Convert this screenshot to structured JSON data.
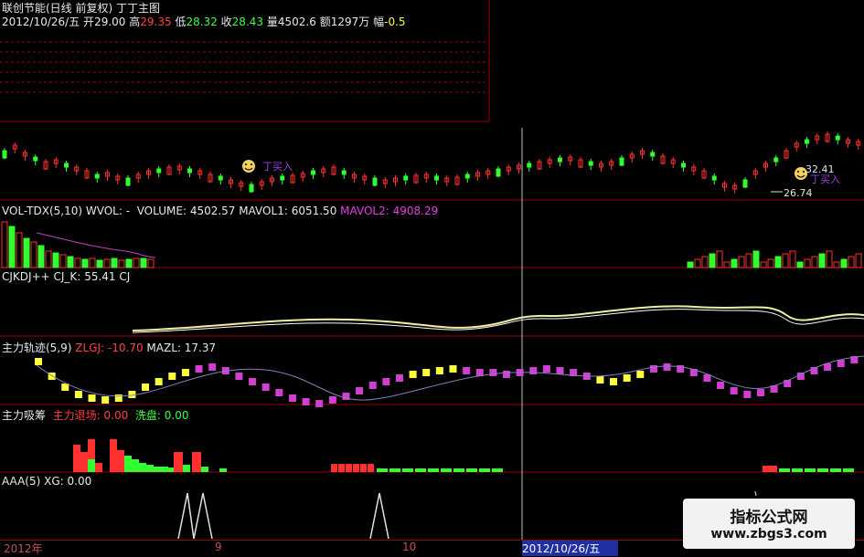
{
  "header": {
    "title": "联创节能(日线 前复权) 丁丁主图",
    "date": "2012/10/26/五",
    "open_label": "开",
    "open": "29.00",
    "high_label": "高",
    "high": "29.35",
    "low_label": "低",
    "low": "28.32",
    "close_label": "收",
    "close": "28.43",
    "vol_label": "量",
    "vol": "4502.6",
    "amt_label": "额",
    "amt": "1297万",
    "amp_label": "幅",
    "amp": "-0.5"
  },
  "main_panel": {
    "annotation_buy": "丁买入",
    "annotation_sell_hint": "丁买入",
    "price_high_mark": "32.41",
    "price_low_mark": "26.74",
    "smiley_icon": "smiley-icon"
  },
  "vol_panel": {
    "name": "VOL-TDX(5,10)",
    "wvol": "WVOL: -",
    "volume_label": "VOLUME:",
    "volume": "4502.57",
    "mavol1_label": "MAVOL1:",
    "mavol1": "6051.50",
    "mavol2_label": "MAVOL2:",
    "mavol2": "4908.29"
  },
  "kdj_panel": {
    "name": "CJKDJ++",
    "cjk_label": "CJ_K:",
    "cjk": "55.41",
    "cj": "CJ"
  },
  "zl_panel": {
    "name": "主力轨迹(5,9)",
    "zlgj_label": "ZLGJ:",
    "zlgj": "-10.70",
    "mazl_label": "MAZL:",
    "mazl": "17.37"
  },
  "xc_panel": {
    "name": "主力吸筹",
    "exit_label": "主力退场:",
    "exit": "0.00",
    "wash_label": "洗盘:",
    "wash": "0.00"
  },
  "aaa_panel": {
    "name": "AAA(5)",
    "xg_label": "XG:",
    "xg": "0.00"
  },
  "footer": {
    "year": "2012年",
    "m9": "9",
    "m10": "10",
    "cursor_date": "2012/10/26/五"
  },
  "watermark": {
    "line1": "指标公式网",
    "line2": "www.zbgs3.com"
  },
  "colors": {
    "up": "#ff3030",
    "down": "#30ff30",
    "grid": "#a00000",
    "bg": "#000000"
  }
}
